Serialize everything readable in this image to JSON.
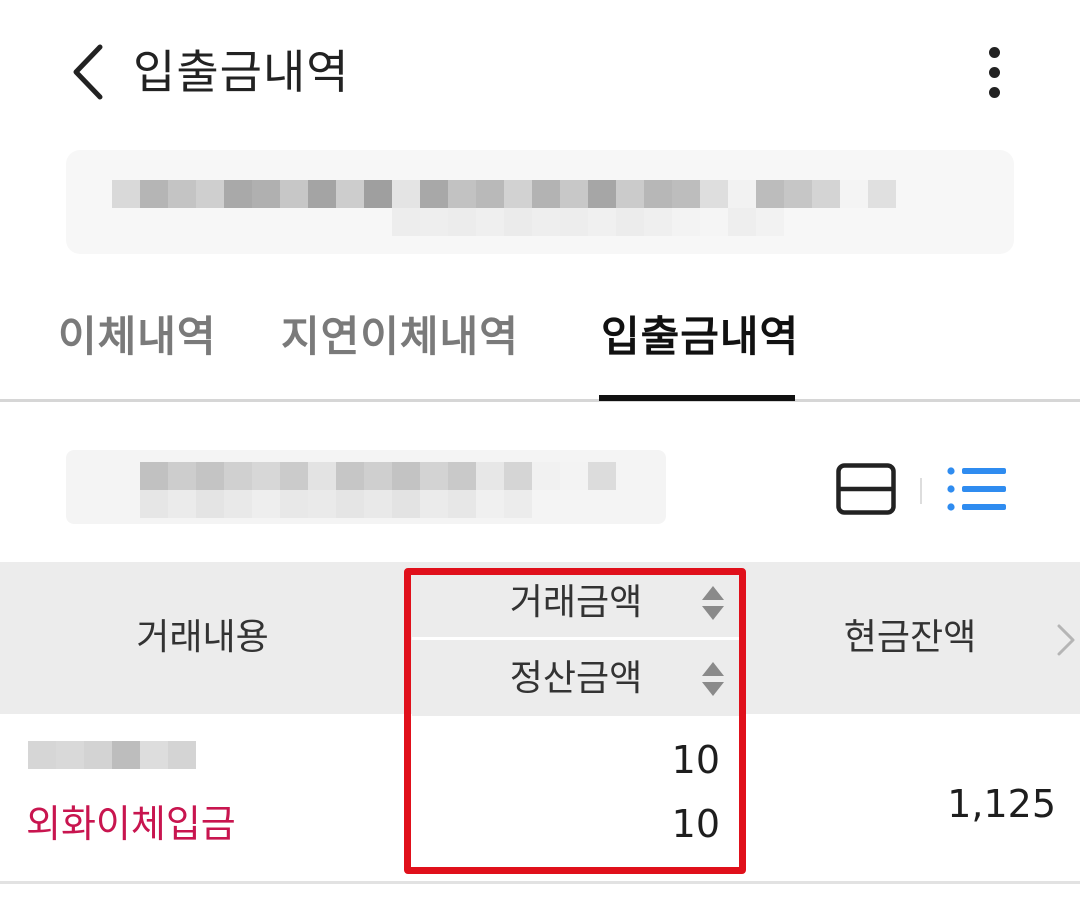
{
  "header": {
    "title": "입출금내역",
    "back_icon": "chevron-left-icon",
    "more_icon": "more-vertical-icon"
  },
  "tabs": [
    {
      "label": "이체내역",
      "active": false
    },
    {
      "label": "지연이체내역",
      "active": false
    },
    {
      "label": "입출금내역",
      "active": true
    }
  ],
  "view_toggle": {
    "card_icon": "card-view-icon",
    "list_icon": "list-view-icon",
    "active": "list",
    "active_color": "#2f8cf0"
  },
  "table": {
    "columns": {
      "description": "거래내용",
      "transaction_amount": "거래금액",
      "settlement_amount": "정산금액",
      "cash_balance": "현금잔액"
    },
    "rows": [
      {
        "type": "외화이체입금",
        "transaction_amount": "10",
        "settlement_amount": "10",
        "cash_balance": "1,125"
      }
    ]
  },
  "colors": {
    "highlight": "#e0101b",
    "deposit_text": "#c8154f",
    "header_bg": "#ececec"
  }
}
